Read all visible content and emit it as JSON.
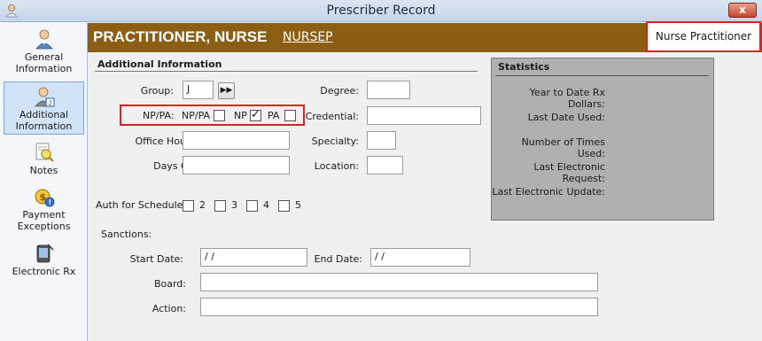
{
  "window": {
    "title": "Prescriber Record",
    "close_label": "x"
  },
  "sidebar": {
    "items": [
      {
        "label": "General\nInformation",
        "icon": "person-icon"
      },
      {
        "label": "Additional\nInformation",
        "icon": "person-badge-icon",
        "active": true
      },
      {
        "label": "Notes",
        "icon": "notes-magnify-icon"
      },
      {
        "label": "Payment\nExceptions",
        "icon": "payment-coin-icon"
      },
      {
        "label": "Electronic Rx",
        "icon": "electronic-rx-icon"
      }
    ]
  },
  "header": {
    "name": "PRACTITIONER, NURSE",
    "code": "NURSEP",
    "role": "Nurse Practitioner"
  },
  "form": {
    "section_title": "Additional Information",
    "group_label": "Group:",
    "group_value": "J",
    "group_button": "▶▶",
    "nppa_label": "NP/PA:",
    "nppa_options": [
      {
        "label": "NP/PA",
        "checked": false
      },
      {
        "label": "NP",
        "checked": true
      },
      {
        "label": "PA",
        "checked": false
      }
    ],
    "office_hours_label": "Office Hours:",
    "office_hours_value": "",
    "days_off_label": "Days Off:",
    "days_off_value": "",
    "degree_label": "Degree:",
    "degree_value": "",
    "credential_label": "Credential:",
    "credential_value": "",
    "specialty_label": "Specialty:",
    "specialty_value": "",
    "location_label": "Location:",
    "location_value": "",
    "auth_label": "Auth for Schedule:",
    "auth_options": [
      "2",
      "3",
      "4",
      "5"
    ],
    "sanctions_label": "Sanctions:",
    "start_date_label": "Start Date:",
    "start_date_value": " / /",
    "end_date_label": "End Date:",
    "end_date_value": " / /",
    "board_label": "Board:",
    "board_value": "",
    "action_label": "Action:",
    "action_value": ""
  },
  "statistics": {
    "title": "Statistics",
    "rows": [
      "Year to Date Rx Dollars:",
      "Last Date Used:",
      "Number of Times Used:",
      "Last Electronic Request:",
      "Last Electronic Update:"
    ]
  },
  "colors": {
    "header_bg": "#8b5e14",
    "highlight_red": "#e02020",
    "stats_bg": "#b0b0b0",
    "active_nav_bg": "#d3e3f7"
  }
}
